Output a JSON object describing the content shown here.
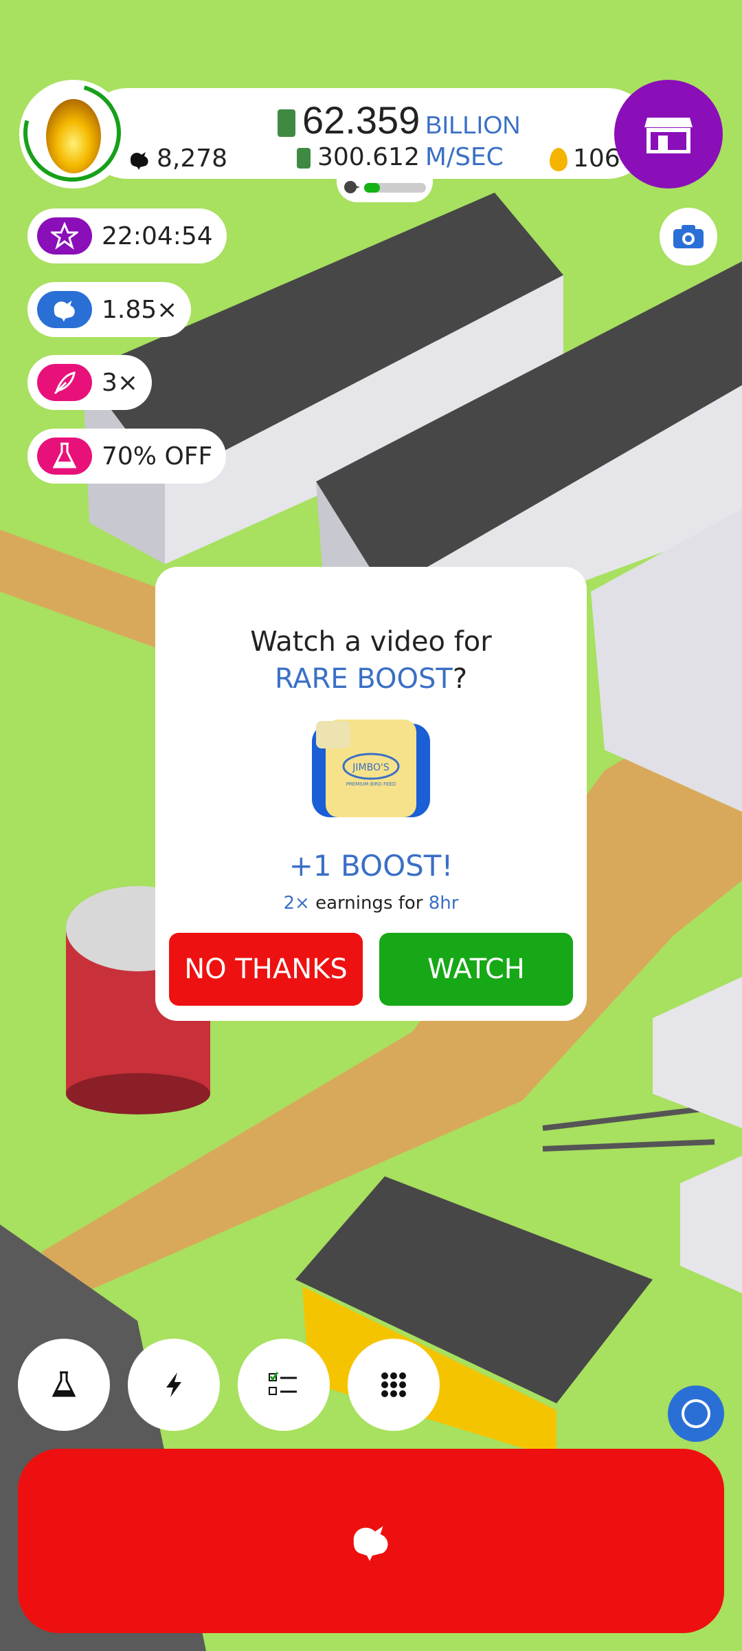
{
  "hud": {
    "money_value": "62.359",
    "money_unit": "BILLION",
    "rate_value": "300.612",
    "rate_unit": "M/SEC",
    "chicken_count": "8,278",
    "golden_eggs": "106",
    "hatchery_progress": 0.25
  },
  "boosts": [
    {
      "icon": "star-icon",
      "label": "22:04:54",
      "color": "#8a0fb8"
    },
    {
      "icon": "chicken-icon",
      "label": "1.85×",
      "color": "#2a6fd6"
    },
    {
      "icon": "feather-icon",
      "label": "3×",
      "color": "#e8117a"
    },
    {
      "icon": "flask-icon",
      "label": "70% OFF",
      "color": "#e8117a"
    }
  ],
  "dialog": {
    "title": "Watch a video for",
    "subtitle_highlight": "RARE BOOST",
    "subtitle_end": "?",
    "bag_brand": "JIMBO'S",
    "bag_caption": "PREMIUM BIRD FEED",
    "boost_text": "+1 BOOST!",
    "earn_mult": "2×",
    "earn_mid": " earnings for ",
    "earn_duration": "8hr",
    "no_label": "NO THANKS",
    "watch_label": "WATCH"
  },
  "colors": {
    "grass": "#a8e05f",
    "accent_blue": "#3a6fc6",
    "red": "#ee1111",
    "green": "#16a816",
    "purple": "#8a0fb8"
  }
}
